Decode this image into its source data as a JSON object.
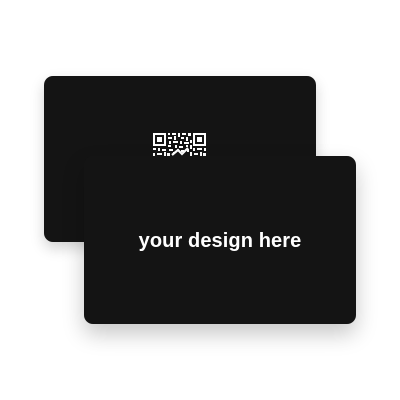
{
  "colors": {
    "background": "#ffffff",
    "card": "#141414",
    "text": "#ffffff",
    "qr": "#ffffff"
  },
  "back_card": {
    "qr_icon": "qr-code-icon"
  },
  "front_card": {
    "text": "your design here"
  }
}
